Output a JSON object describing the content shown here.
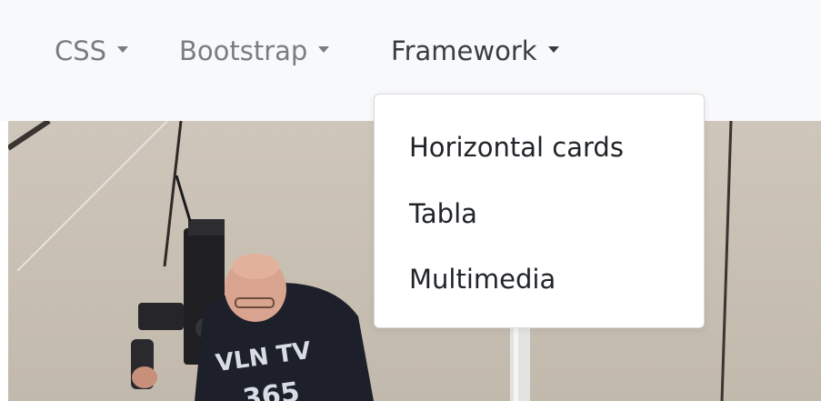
{
  "navbar": {
    "items": [
      {
        "label": "CSS"
      },
      {
        "label": "Bootstrap"
      },
      {
        "label": "Framework"
      }
    ]
  },
  "dropdown": {
    "items": [
      {
        "label": "Horizontal cards"
      },
      {
        "label": "Tabla"
      },
      {
        "label": "Multimedia"
      }
    ]
  },
  "photo": {
    "shirt_text": "VLN TV",
    "shirt_number": "365"
  }
}
